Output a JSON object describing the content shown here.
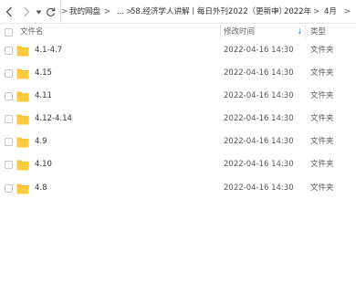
{
  "toolbar": {
    "icons": [
      "back-icon",
      "forward-icon",
      "history-dropdown-icon",
      "refresh-icon"
    ],
    "breadcrumb": [
      {
        "label": "我的网盘"
      },
      {
        "label": "..."
      },
      {
        "label": "58.经济学人讲解丨每日外刊2022（更新中）"
      },
      {
        "label": "2022年"
      },
      {
        "label": "4月"
      }
    ],
    "separator": ">",
    "overflow_separator": ">"
  },
  "columns": {
    "name": "文件名",
    "modified": "修改时间",
    "type": "类型",
    "sort_indicator": "↓"
  },
  "colors": {
    "folder": "#f8c32e",
    "accent": "#3b8cf7"
  },
  "files": [
    {
      "name": "4.1-4.7",
      "modified": "2022-04-16 14:30",
      "type": "文件夹",
      "icon": "folder-icon"
    },
    {
      "name": "4.15",
      "modified": "2022-04-16 14:30",
      "type": "文件夹",
      "icon": "folder-icon"
    },
    {
      "name": "4.11",
      "modified": "2022-04-16 14:30",
      "type": "文件夹",
      "icon": "folder-icon"
    },
    {
      "name": "4.12-4.14",
      "modified": "2022-04-16 14:30",
      "type": "文件夹",
      "icon": "folder-icon"
    },
    {
      "name": "4.9",
      "modified": "2022-04-16 14:30",
      "type": "文件夹",
      "icon": "folder-icon"
    },
    {
      "name": "4.10",
      "modified": "2022-04-16 14:30",
      "type": "文件夹",
      "icon": "folder-icon"
    },
    {
      "name": "4.8",
      "modified": "2022-04-16 14:30",
      "type": "文件夹",
      "icon": "folder-icon"
    }
  ]
}
